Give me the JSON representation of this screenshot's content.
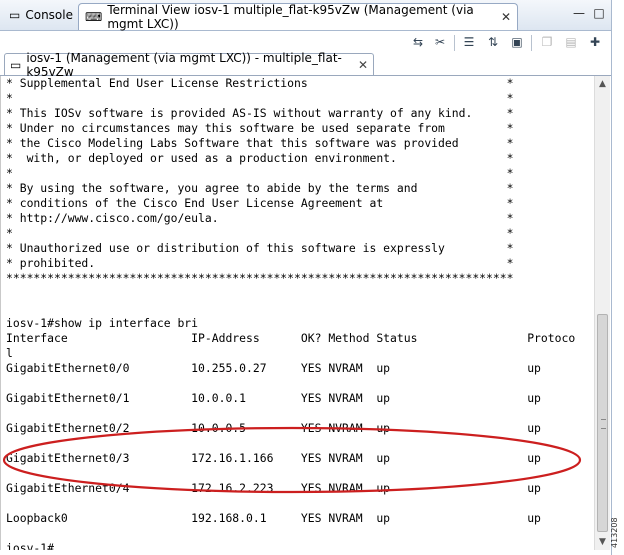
{
  "tabs": {
    "console": "Console",
    "terminal": "Terminal View iosv-1 multiple_flat-k95vZw (Management (via mgmt LXC))"
  },
  "inner_tab": "iosv-1 (Management (via mgmt LXC)) - multiple_flat-k95vZw",
  "terminal_lines": [
    "* Supplemental End User License Restrictions                             *",
    "*                                                                        *",
    "* This IOSv software is provided AS-IS without warranty of any kind.     *",
    "* Under no circumstances may this software be used separate from         *",
    "* the Cisco Modeling Labs Software that this software was provided       *",
    "*  with, or deployed or used as a production environment.                *",
    "*                                                                        *",
    "* By using the software, you agree to abide by the terms and             *",
    "* conditions of the Cisco End User License Agreement at                  *",
    "* http://www.cisco.com/go/eula.                                          *",
    "*                                                                        *",
    "* Unauthorized use or distribution of this software is expressly         *",
    "* prohibited.                                                            *",
    "**************************************************************************",
    "",
    "",
    "iosv-1#show ip interface bri",
    "Interface                  IP-Address      OK? Method Status                Protoco",
    "l",
    "GigabitEthernet0/0         10.255.0.27     YES NVRAM  up                    up",
    "",
    "GigabitEthernet0/1         10.0.0.1        YES NVRAM  up                    up",
    "",
    "GigabitEthernet0/2         10.0.0.5        YES NVRAM  up                    up",
    "",
    "GigabitEthernet0/3         172.16.1.166    YES NVRAM  up                    up",
    "",
    "GigabitEthernet0/4         172.16.2.223    YES NVRAM  up                    up",
    "",
    "Loopback0                  192.168.0.1     YES NVRAM  up                    up",
    "",
    "iosv-1#"
  ],
  "figure_number": "413208",
  "colors": {
    "annotation": "#cc1f1f",
    "tab_bar": "#dde6f1"
  }
}
